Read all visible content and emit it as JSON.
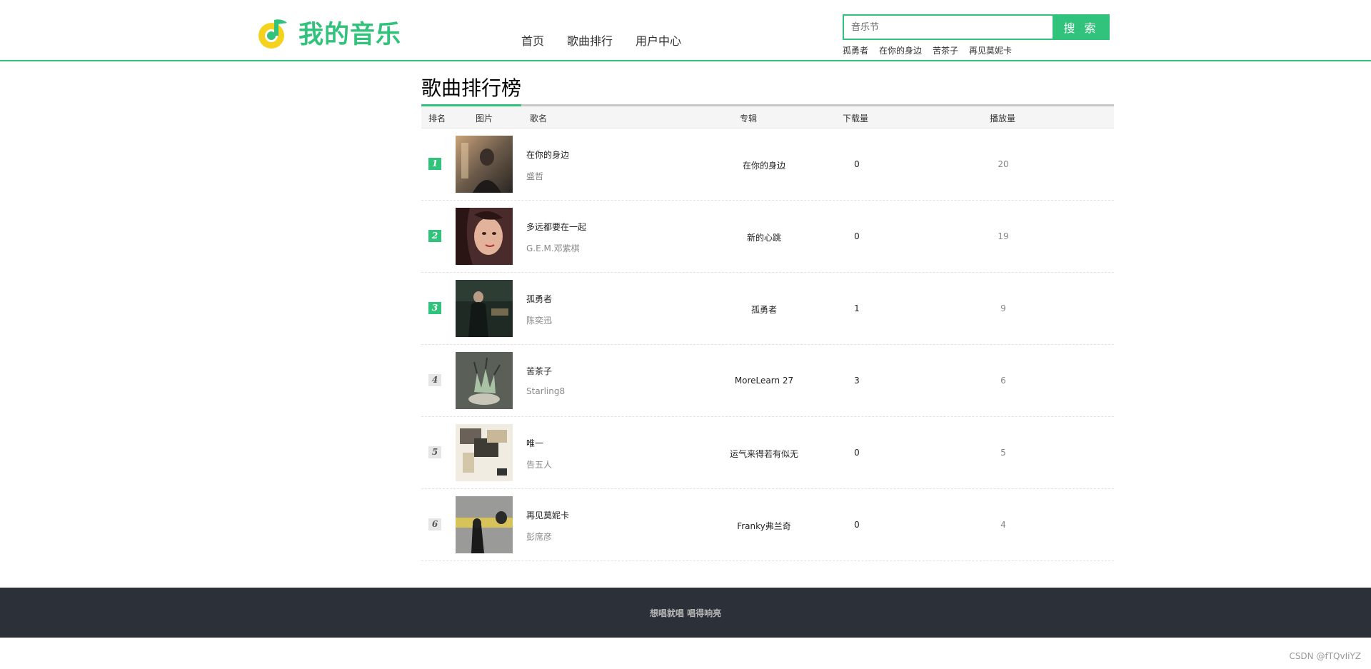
{
  "brand": {
    "name": "我的音乐",
    "primary_color": "#31c27c",
    "logo_icon": "music-note-icon"
  },
  "nav": {
    "items": [
      "首页",
      "歌曲排行",
      "用户中心"
    ]
  },
  "search": {
    "placeholder": "音乐节",
    "button_label": "搜 索",
    "hot_words": [
      "孤勇者",
      "在你的身边",
      "苦茶子",
      "再见莫妮卡"
    ]
  },
  "page": {
    "title": "歌曲排行榜"
  },
  "table": {
    "headers": {
      "rank": "排名",
      "picture": "图片",
      "name": "歌名",
      "album": "专辑",
      "downloads": "下载量",
      "plays": "播放量"
    },
    "rows": [
      {
        "rank": "1",
        "title": "在你的身边",
        "artist": "盛哲",
        "album": "在你的身边",
        "downloads": "0",
        "plays": "20"
      },
      {
        "rank": "2",
        "title": "多远都要在一起",
        "artist": "G.E.M.邓紫棋",
        "album": "新的心跳",
        "downloads": "0",
        "plays": "19"
      },
      {
        "rank": "3",
        "title": "孤勇者",
        "artist": "陈奕迅",
        "album": "孤勇者",
        "downloads": "1",
        "plays": "9"
      },
      {
        "rank": "4",
        "title": "苦茶子",
        "artist": "Starling8",
        "album": "MoreLearn 27",
        "downloads": "3",
        "plays": "6"
      },
      {
        "rank": "5",
        "title": "唯一",
        "artist": "告五人",
        "album": "运气来得若有似无",
        "downloads": "0",
        "plays": "5"
      },
      {
        "rank": "6",
        "title": "再见莫妮卡",
        "artist": "彭席彦",
        "album": "Franky弗兰奇",
        "downloads": "0",
        "plays": "4"
      }
    ]
  },
  "footer": {
    "text": "想唱就唱 唱得响亮"
  },
  "watermark": "CSDN @fTQvIiYZ"
}
